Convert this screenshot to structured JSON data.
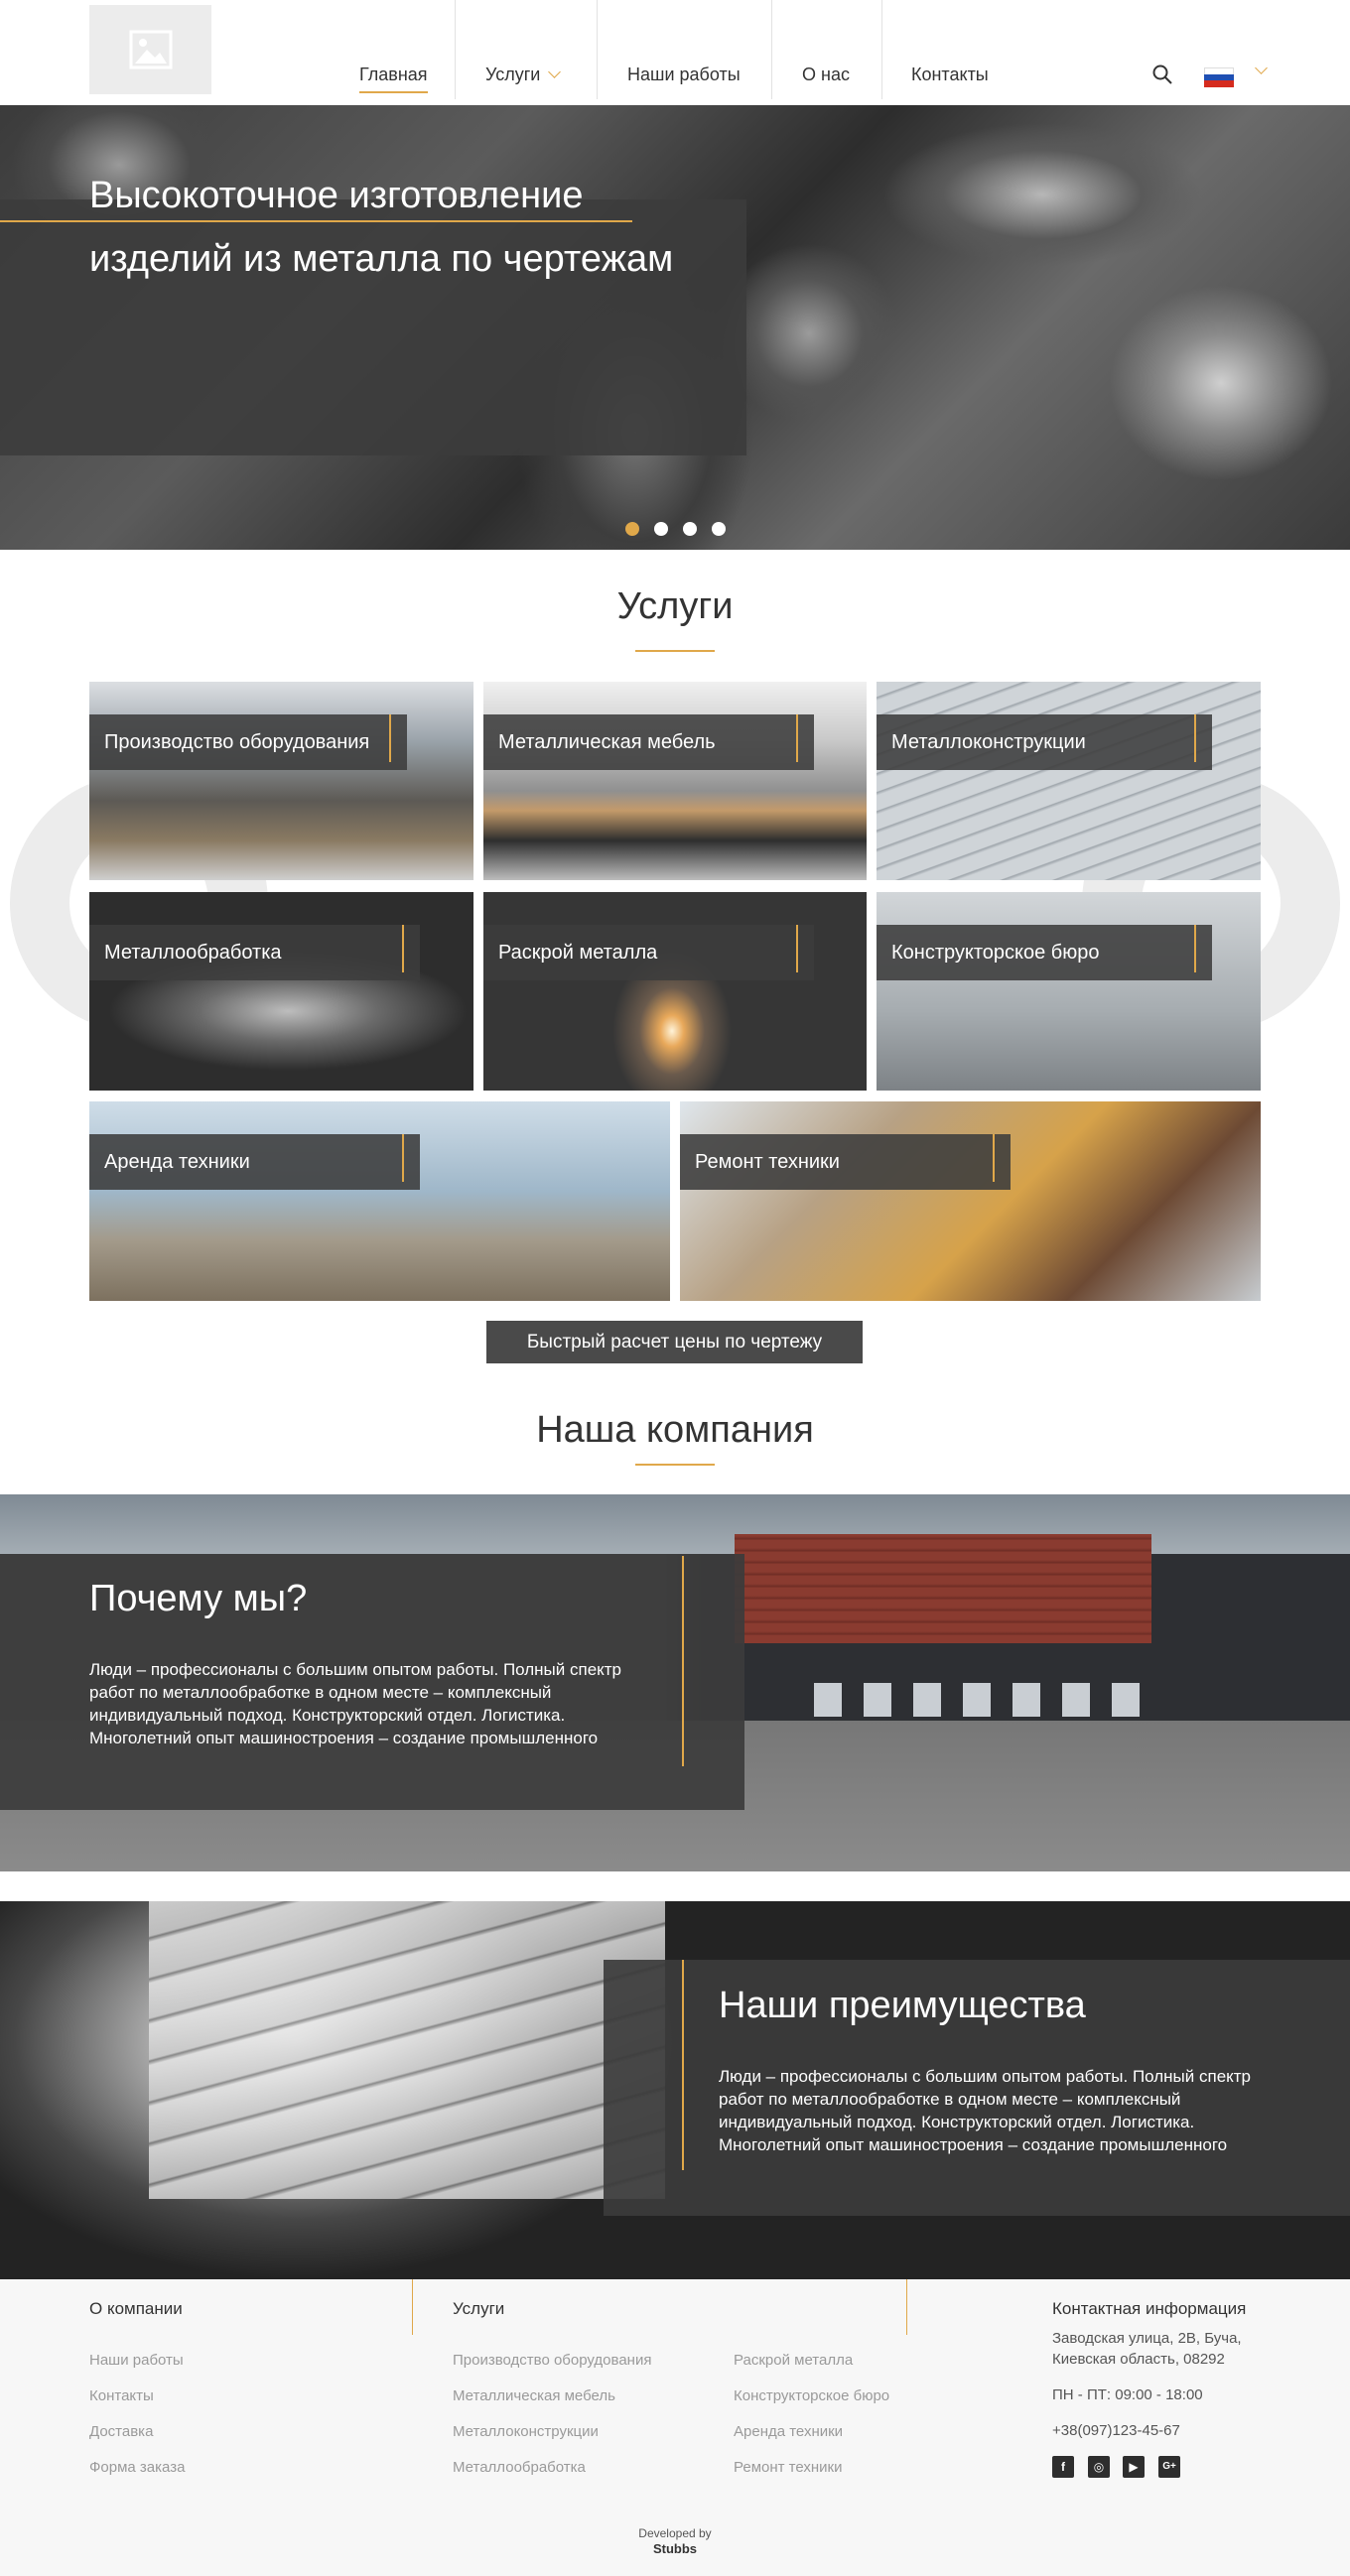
{
  "header": {
    "nav": [
      {
        "label": "Главная",
        "active": true
      },
      {
        "label": "Услуги",
        "has_dropdown": true
      },
      {
        "label": "Наши работы"
      },
      {
        "label": "О нас"
      },
      {
        "label": "Контакты"
      }
    ],
    "search_icon": "search-icon",
    "language_flag": "ru-flag"
  },
  "hero": {
    "title_line1": "Высокоточное изготовление",
    "title_line2": "изделий из металла по чертежам",
    "slides_count": 4,
    "active_slide": 1
  },
  "services": {
    "title": "Услуги",
    "items": [
      "Производство оборудования",
      "Металлическая мебель",
      "Металлоконструкции",
      "Металлообработка",
      "Раскрой металла",
      "Конструкторское бюро",
      "Аренда техники",
      "Ремонт техники"
    ],
    "calc_button": "Быстрый расчет цены по чертежу"
  },
  "company": {
    "title": "Наша компания",
    "why_title": "Почему мы?",
    "why_text": "Люди – профессионалы с большим опытом работы. Полный спектр работ по металлообработке в одном месте – комплексный индивидуальный подход. Конструкторский отдел. Логистика. Многолетний опыт машиностроения – создание промышленного",
    "adv_title": "Наши преимущества",
    "adv_text": "Люди – профессионалы с большим опытом работы. Полный спектр работ по металлообработке в одном месте – комплексный индивидуальный подход. Конструкторский отдел. Логистика. Многолетний опыт машиностроения – создание промышленного"
  },
  "footer": {
    "about_head": "О компании",
    "about_links": [
      "Наши работы",
      "Контакты",
      "Доставка",
      "Форма заказа"
    ],
    "services_head": "Услуги",
    "services_col1": [
      "Производство оборудования",
      "Металлическая мебель",
      "Металлоконструкции",
      "Металлообработка"
    ],
    "services_col2": [
      "Раскрой металла",
      "Конструкторское бюро",
      "Аренда техники",
      "Ремонт техники"
    ],
    "contact_head": "Контактная информация",
    "address_line1": "Заводская улица, 2В, Буча,",
    "address_line2": "Киевская область, 08292",
    "hours": "ПН - ПТ:  09:00 - 18:00",
    "phone": "+38(097)123-45-67",
    "social": [
      "facebook-icon",
      "instagram-icon",
      "youtube-icon",
      "google-plus-icon"
    ],
    "dev_label": "Developed by",
    "dev_name": "Stubbs"
  },
  "colors": {
    "accent": "#e0a84a",
    "panel": "#3c3c3c",
    "footer_bg": "#f7f7f7"
  }
}
